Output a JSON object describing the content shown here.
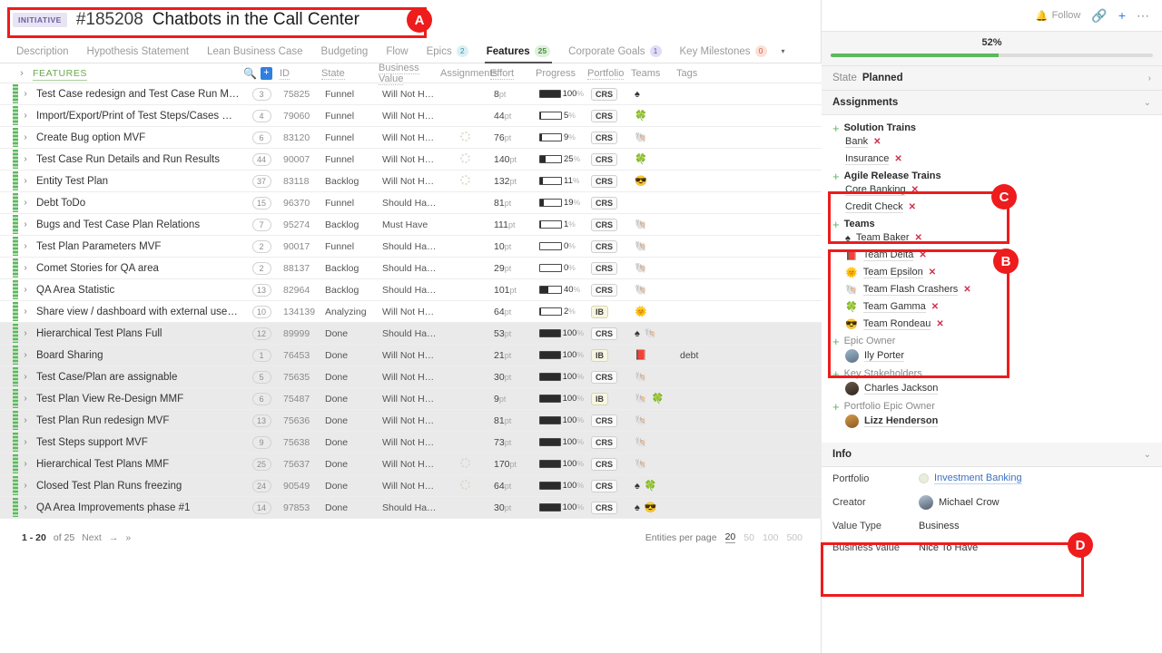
{
  "header": {
    "badge": "INITIATIVE",
    "entity_id": "#185208",
    "title": "Chatbots in the Call Center"
  },
  "tabs": [
    {
      "label": "Description",
      "count": null,
      "active": false
    },
    {
      "label": "Hypothesis Statement",
      "count": null,
      "active": false
    },
    {
      "label": "Lean Business Case",
      "count": null,
      "active": false
    },
    {
      "label": "Budgeting",
      "count": null,
      "active": false
    },
    {
      "label": "Flow",
      "count": null,
      "active": false
    },
    {
      "label": "Epics",
      "count": "2",
      "active": false,
      "cnt_class": "c-epics"
    },
    {
      "label": "Features",
      "count": "25",
      "active": true,
      "cnt_class": "c-features"
    },
    {
      "label": "Corporate Goals",
      "count": "1",
      "active": false,
      "cnt_class": "c-goals"
    },
    {
      "label": "Key Milestones",
      "count": "0",
      "active": false,
      "cnt_class": "c-miles"
    }
  ],
  "tab_overflow_icon": "caret-down-icon",
  "grid": {
    "group_label": "FEATURES",
    "search_icon": "search-icon",
    "add_icon": "plus-icon",
    "columns": [
      "ID",
      "State",
      "Business Value",
      "Assignments",
      "Effort",
      "Progress",
      "Portfolio",
      "Teams",
      "Tags"
    ],
    "rows": [
      {
        "name": "Test Case redesign and Test Case Run MMF",
        "rank": "3",
        "id": "75825",
        "state": "Funnel",
        "bv": "Will Not Have",
        "assign": false,
        "effort": "8",
        "progress": 100,
        "portfolio": "CRS",
        "teams": "♠",
        "tags": "",
        "done": false
      },
      {
        "name": "Import/Export/Print of Test Steps/Cases MMF",
        "rank": "4",
        "id": "79060",
        "state": "Funnel",
        "bv": "Will Not Have",
        "assign": false,
        "effort": "44",
        "progress": 5,
        "portfolio": "CRS",
        "teams": "🍀",
        "tags": "",
        "done": false
      },
      {
        "name": "Create Bug option MVF",
        "rank": "6",
        "id": "83120",
        "state": "Funnel",
        "bv": "Will Not Have",
        "assign": true,
        "effort": "76",
        "progress": 9,
        "portfolio": "CRS",
        "teams": "🐚",
        "tags": "",
        "done": false
      },
      {
        "name": "Test Case Run Details and Run Results",
        "rank": "44",
        "id": "90007",
        "state": "Funnel",
        "bv": "Will Not Have",
        "assign": true,
        "effort": "140",
        "progress": 25,
        "portfolio": "CRS",
        "teams": "🍀",
        "tags": "",
        "done": false
      },
      {
        "name": "Entity Test Plan",
        "rank": "37",
        "id": "83118",
        "state": "Backlog",
        "bv": "Will Not Have",
        "assign": true,
        "effort": "132",
        "progress": 11,
        "portfolio": "CRS",
        "teams": "😎",
        "tags": "",
        "done": false
      },
      {
        "name": "Debt ToDo",
        "rank": "15",
        "id": "96370",
        "state": "Funnel",
        "bv": "Should Have",
        "assign": false,
        "effort": "81",
        "progress": 19,
        "portfolio": "CRS",
        "teams": "",
        "tags": "",
        "done": false
      },
      {
        "name": "Bugs and Test Case Plan Relations",
        "rank": "7",
        "id": "95274",
        "state": "Backlog",
        "bv": "Must Have",
        "assign": false,
        "effort": "111",
        "progress": 1,
        "portfolio": "CRS",
        "teams": "🐚",
        "tags": "",
        "done": false
      },
      {
        "name": "Test Plan Parameters MVF",
        "rank": "2",
        "id": "90017",
        "state": "Funnel",
        "bv": "Should Have",
        "assign": false,
        "effort": "10",
        "progress": 0,
        "portfolio": "CRS",
        "teams": "🐚",
        "tags": "",
        "done": false
      },
      {
        "name": "Comet Stories for QA area",
        "rank": "2",
        "id": "88137",
        "state": "Backlog",
        "bv": "Should Have",
        "assign": false,
        "effort": "29",
        "progress": 0,
        "portfolio": "CRS",
        "teams": "🐚",
        "tags": "",
        "done": false
      },
      {
        "name": "QA Area Statistic",
        "rank": "13",
        "id": "82964",
        "state": "Backlog",
        "bv": "Should Have",
        "assign": false,
        "effort": "101",
        "progress": 40,
        "portfolio": "CRS",
        "teams": "🐚",
        "tags": "",
        "done": false
      },
      {
        "name": "Share view / dashboard with external users - improv...",
        "rank": "10",
        "id": "134139",
        "state": "Analyzing",
        "bv": "Will Not Have",
        "assign": false,
        "effort": "64",
        "progress": 2,
        "portfolio": "IB",
        "teams": "🌞",
        "tags": "",
        "done": false
      },
      {
        "name": "Hierarchical Test Plans Full",
        "rank": "12",
        "id": "89999",
        "state": "Done",
        "bv": "Should Have",
        "assign": false,
        "effort": "53",
        "progress": 100,
        "portfolio": "CRS",
        "teams": "♠ 🐚",
        "tags": "",
        "done": true
      },
      {
        "name": "Board Sharing",
        "rank": "1",
        "id": "76453",
        "state": "Done",
        "bv": "Will Not Have",
        "assign": false,
        "effort": "21",
        "progress": 100,
        "portfolio": "IB",
        "teams": "📕",
        "tags": "debt",
        "done": true
      },
      {
        "name": "Test Case/Plan are assignable",
        "rank": "5",
        "id": "75635",
        "state": "Done",
        "bv": "Will Not Have",
        "assign": false,
        "effort": "30",
        "progress": 100,
        "portfolio": "CRS",
        "teams": "🐚",
        "tags": "",
        "done": true
      },
      {
        "name": "Test Plan View Re-Design MMF",
        "rank": "6",
        "id": "75487",
        "state": "Done",
        "bv": "Will Not Have",
        "assign": false,
        "effort": "9",
        "progress": 100,
        "portfolio": "IB",
        "teams": "🐚 🍀",
        "tags": "",
        "done": true
      },
      {
        "name": "Test Plan Run redesign MVF",
        "rank": "13",
        "id": "75636",
        "state": "Done",
        "bv": "Will Not Have",
        "assign": false,
        "effort": "81",
        "progress": 100,
        "portfolio": "CRS",
        "teams": "🐚",
        "tags": "",
        "done": true
      },
      {
        "name": "Test Steps support MVF",
        "rank": "9",
        "id": "75638",
        "state": "Done",
        "bv": "Will Not Have",
        "assign": false,
        "effort": "73",
        "progress": 100,
        "portfolio": "CRS",
        "teams": "🐚",
        "tags": "",
        "done": true
      },
      {
        "name": "Hierarchical Test Plans MMF",
        "rank": "25",
        "id": "75637",
        "state": "Done",
        "bv": "Will Not Have",
        "assign": true,
        "effort": "170",
        "progress": 100,
        "portfolio": "CRS",
        "teams": "🐚",
        "tags": "",
        "done": true
      },
      {
        "name": "Closed Test Plan Runs freezing",
        "rank": "24",
        "id": "90549",
        "state": "Done",
        "bv": "Will Not Have",
        "assign": true,
        "effort": "64",
        "progress": 100,
        "portfolio": "CRS",
        "teams": "♠ 🍀",
        "tags": "",
        "done": true
      },
      {
        "name": "QA Area Improvements phase #1",
        "rank": "14",
        "id": "97853",
        "state": "Done",
        "bv": "Should Have",
        "assign": false,
        "effort": "30",
        "progress": 100,
        "portfolio": "CRS",
        "teams": "♠ 😎",
        "tags": "",
        "done": true
      }
    ]
  },
  "pager": {
    "range": "1 - 20",
    "of": "of 25",
    "next": "Next",
    "next_icon": "arrow-right-icon",
    "last_icon": "double-arrow-right-icon",
    "per_page_label": "Entities per page",
    "options": [
      "20",
      "50",
      "100",
      "500"
    ],
    "selected": "20"
  },
  "sidebar": {
    "top_actions": {
      "follow": "Follow",
      "bell_icon": "bell-icon",
      "link_icon": "link-icon",
      "plus_icon": "plus-icon",
      "more_icon": "ellipsis-icon"
    },
    "progress": {
      "percent_label": "52%",
      "percent": 52
    },
    "state": {
      "label": "State",
      "value": "Planned",
      "chevron_icon": "chevron-right-icon"
    },
    "assignments": {
      "title": "Assignments",
      "chevron_icon": "chevron-down-icon",
      "groups": [
        {
          "title": "Solution Trains",
          "bold": true,
          "items": [
            {
              "label": "Bank"
            },
            {
              "label": "Insurance"
            }
          ]
        },
        {
          "title": "Agile Release Trains",
          "bold": true,
          "items": [
            {
              "label": "Core Banking"
            },
            {
              "label": "Credit Check"
            }
          ]
        },
        {
          "title": "Teams",
          "bold": true,
          "items": [
            {
              "label": "Team Baker",
              "emoji": "♠"
            },
            {
              "label": "Team Delta",
              "emoji": "📕"
            },
            {
              "label": "Team Epsilon",
              "emoji": "🌞"
            },
            {
              "label": "Team Flash Crashers",
              "emoji": "🐚"
            },
            {
              "label": "Team Gamma",
              "emoji": "🍀"
            },
            {
              "label": "Team Rondeau",
              "emoji": "😎"
            }
          ]
        },
        {
          "title": "Epic Owner",
          "bold": false,
          "people": [
            {
              "name": "Ily Porter",
              "avatar": "a"
            }
          ]
        },
        {
          "title": "Key Stakeholders",
          "bold": false,
          "people": [
            {
              "name": "Charles Jackson",
              "avatar": "b"
            }
          ]
        },
        {
          "title": "Portfolio Epic Owner",
          "bold": false,
          "people": [
            {
              "name": "Lizz Henderson",
              "avatar": "c",
              "bold": true
            }
          ]
        }
      ]
    },
    "info": {
      "title": "Info",
      "chevron_icon": "chevron-down-icon",
      "rows": [
        {
          "key": "Portfolio",
          "value": "Investment Banking",
          "type": "link"
        },
        {
          "key": "Creator",
          "value": "Michael Crow",
          "type": "person"
        },
        {
          "key": "Value Type",
          "value": "Business",
          "type": "text"
        },
        {
          "key": "Business value",
          "value": "Nice To Have",
          "type": "text"
        }
      ]
    }
  },
  "annotations": [
    {
      "id": "A",
      "label": "A"
    },
    {
      "id": "B",
      "label": "B"
    },
    {
      "id": "C",
      "label": "C"
    },
    {
      "id": "D",
      "label": "D"
    }
  ]
}
